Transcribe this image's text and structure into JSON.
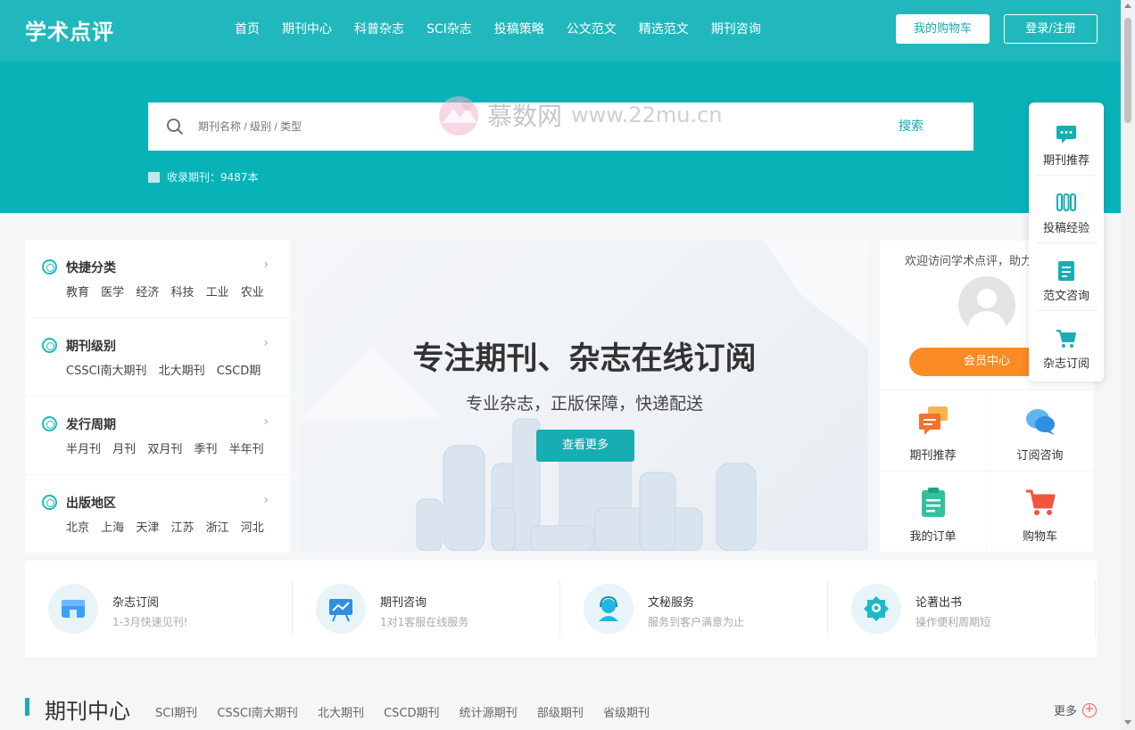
{
  "header": {
    "logo": "学术点评",
    "nav": [
      "首页",
      "期刊中心",
      "科普杂志",
      "SCI杂志",
      "投稿策略",
      "公文范文",
      "精选范文",
      "期刊咨询"
    ],
    "cart_button": "我的购物车",
    "login_button": "登录/注册"
  },
  "search": {
    "placeholder": "期刊名称 / 级别 / 类型",
    "button": "搜索",
    "count_label": "收录期刊：9487本"
  },
  "watermark": {
    "name": "慕数网",
    "url": "www.22mu.cn"
  },
  "categories": [
    {
      "title": "快捷分类",
      "tags": [
        "教育",
        "医学",
        "经济",
        "科技",
        "工业",
        "农业"
      ]
    },
    {
      "title": "期刊级别",
      "tags": [
        "CSSCI南大期刊",
        "北大期刊",
        "CSCD期"
      ]
    },
    {
      "title": "发行周期",
      "tags": [
        "半月刊",
        "月刊",
        "双月刊",
        "季刊",
        "半年刊"
      ]
    },
    {
      "title": "出版地区",
      "tags": [
        "北京",
        "上海",
        "天津",
        "江苏",
        "浙江",
        "河北"
      ]
    }
  ],
  "banner": {
    "title": "专注期刊、杂志在线订阅",
    "subtitle": "专业杂志，正版保障，快递配送",
    "button": "查看更多"
  },
  "user": {
    "welcome": "欢迎访问学术点评，助力",
    "member_button": "会员中心"
  },
  "services": [
    "期刊推荐",
    "订阅咨询",
    "我的订单",
    "购物车"
  ],
  "float_menu": [
    "期刊推荐",
    "投稿经验",
    "范文咨询",
    "杂志订阅"
  ],
  "features": [
    {
      "title": "杂志订阅",
      "desc": "1-3月快速见刊!"
    },
    {
      "title": "期刊咨询",
      "desc": "1对1客服在线服务"
    },
    {
      "title": "文秘服务",
      "desc": "服务到客户满意为止"
    },
    {
      "title": "论著出书",
      "desc": "操作便利周期短"
    }
  ],
  "journal_center": {
    "title": "期刊中心",
    "tabs": [
      "SCI期刊",
      "CSSCI南大期刊",
      "北大期刊",
      "CSCD期刊",
      "统计源期刊",
      "部级期刊",
      "省级期刊"
    ],
    "more": "更多",
    "more_icon": "+"
  },
  "colors": {
    "accent": "#21b8bd",
    "hero": "#08b3b8",
    "orange": "#fb8b24"
  }
}
